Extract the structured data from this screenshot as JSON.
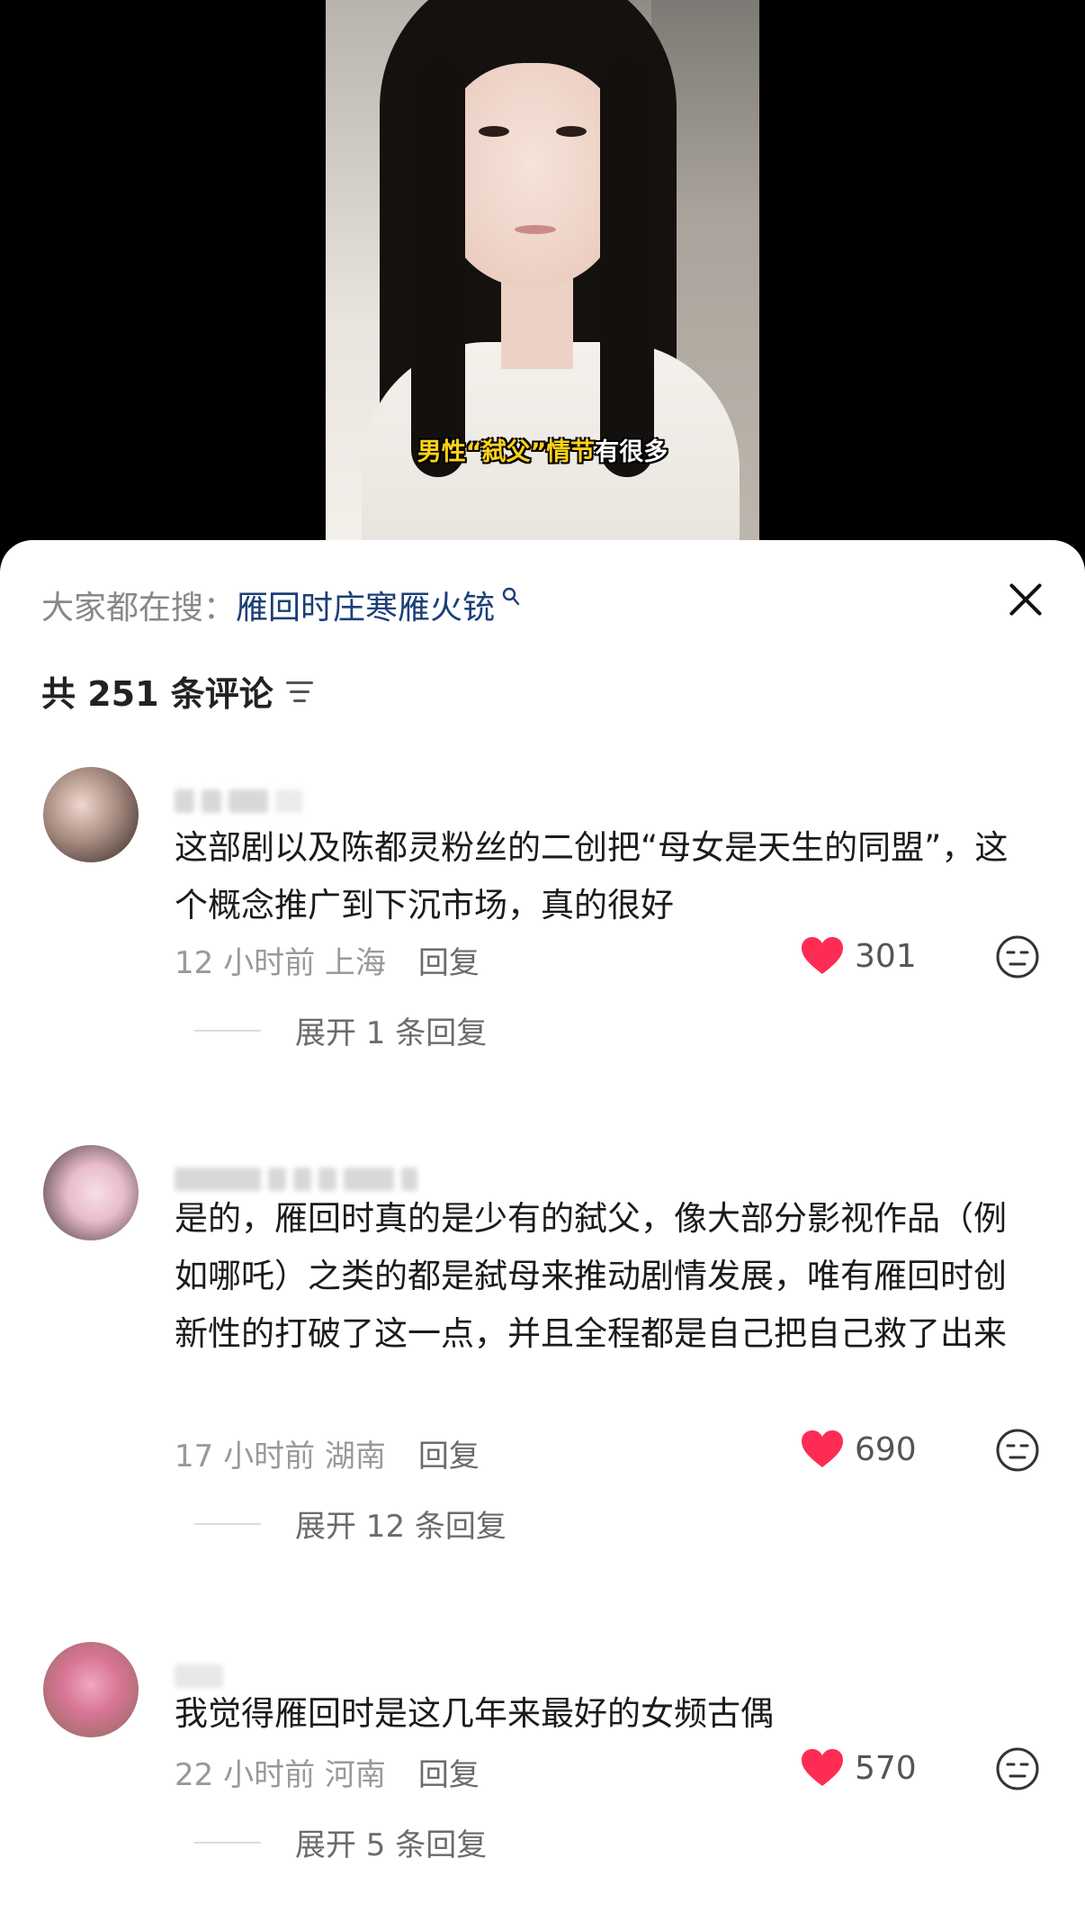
{
  "video": {
    "caption_parts": [
      "男性",
      "“弑父”",
      "情节",
      "有很多"
    ]
  },
  "sheet": {
    "search_label": "大家都在搜：",
    "search_term": "雁回时庄寒雁火铳",
    "comment_count": "共 251 条评论"
  },
  "comments": [
    {
      "text": "这部剧以及陈都灵粉丝的二创把“母女是天生的同盟”，这个概念推广到下沉市场，真的很好",
      "time": "12 小时前",
      "location": "上海",
      "reply": "回复",
      "likes": "301",
      "expand": "展开 1 条回复"
    },
    {
      "text": "是的，雁回时真的是少有的弑父，像大部分影视作品（例如哪吒）之类的都是弑母来推动剧情发展，唯有雁回时创新性的打破了这一点，并且全程都是自己把自己救了出来",
      "time": "17 小时前",
      "location": "湖南",
      "reply": "回复",
      "likes": "690",
      "expand": "展开 12 条回复"
    },
    {
      "text": "我觉得雁回时是这几年来最好的女频古偶",
      "time": "22 小时前",
      "location": "河南",
      "reply": "回复",
      "likes": "570",
      "expand": "展开 5 条回复"
    }
  ],
  "colors": {
    "heart": "#fe2c55",
    "search_term": "#1c3f77",
    "caption": "#ffd21a"
  },
  "icons": [
    "close-icon",
    "sort-icon",
    "search-icon",
    "heart-icon",
    "emoji-face-icon"
  ]
}
